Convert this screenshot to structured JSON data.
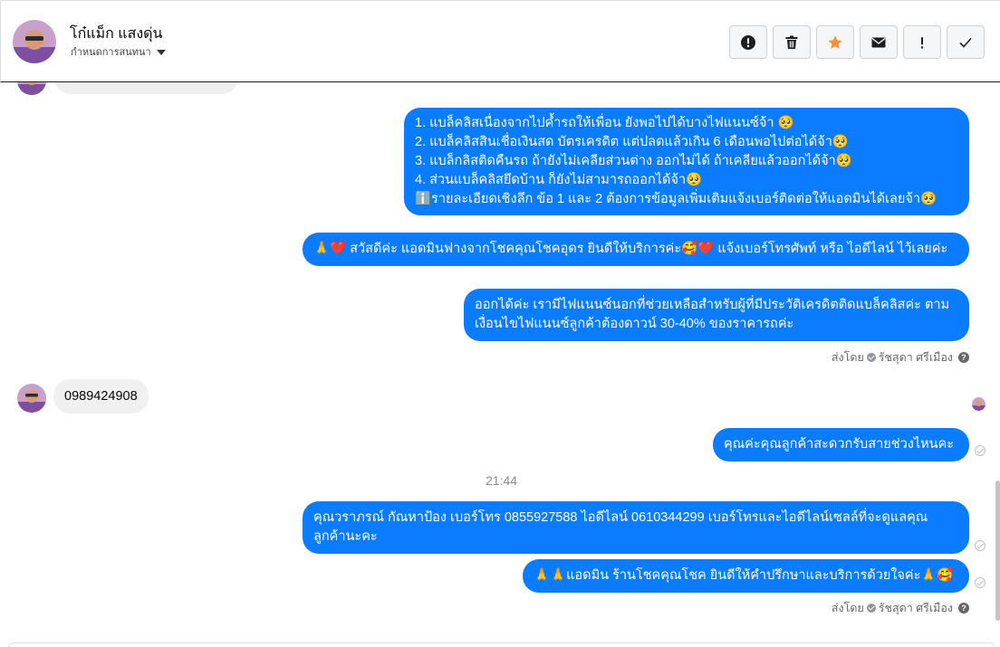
{
  "header": {
    "contact_name": "โก๋แม็ก แสงดุ่น",
    "assign_label": "กำหนดการสนทนา",
    "avatar_icon": "user-avatar",
    "toolbar": [
      {
        "name": "spam-button",
        "icon": "alert-circle-icon"
      },
      {
        "name": "delete-button",
        "icon": "trash-icon"
      },
      {
        "name": "star-button",
        "icon": "star-icon"
      },
      {
        "name": "mark-unread-button",
        "icon": "envelope-icon"
      },
      {
        "name": "follow-up-button",
        "icon": "exclamation-icon"
      },
      {
        "name": "mark-done-button",
        "icon": "checkmark-icon"
      }
    ]
  },
  "conversation": {
    "msg1_lines": [
      "1. แบล็คลิสเนื่องจากไปค้ำรถให้เพื่อน ยังพอไปได้บางไฟแนนซ์จ้า 🥺",
      "2. แบล็คลิสสินเชื่อเงินสด บัตรเครดิต แต่ปลดแล้วเกิน 6 เดือนพอไปต่อได้จ้า🥺",
      "3. แบล็กลิสติดคืนรถ ถ้ายังไม่เคลียส่วนต่าง ออกไม่ได้ ถ้าเคลียแล้วออกได้จ้า🥺",
      "4. ส่วนแบล็คลิสยึดบ้าน ก็ยังไม่สามารถออกได้จ้า🥺",
      "ℹ️รายละเอียดเชิงลึก ข้อ 1 และ 2 ต้องการข้อมูลเพิ่มเติมแจ้งเบอร์ติดต่อให้แอดมินได้เลยจ้า🥺"
    ],
    "msg2": "🙏❤️ สวัสดีค่ะ แอดมินฟางจากโชคคุณโชคอุดร ยินดีให้บริการค่ะ🥰❤️ แจ้งเบอร์โทรศัพท์ หรือ ไอดีไลน์  ไว้เลยค่ะ",
    "msg3": "ออกได้ค่ะ เรามีไฟแนนซ์นอกที่ช่วยเหลือสำหรับผู้ที่มีประวัติเครดิตติดแบล็คลิสค่ะ ตามเงื่อนไขไฟแนนซ์ลูกค้าต้องดาวน์ 30-40% ของราคารถค่ะ",
    "sent_by_label": "ส่งโดย",
    "sent_by_name": "รัชสุดา ศรีเมือง",
    "incoming_phone": "0989424908",
    "msg4": "คุณค่ะคุณลูกค้าสะดวกรับสายช่วงไหนคะ",
    "timestamp": "21:44",
    "msg5": "คุณวราภรณ์ กัณหาป้อง  เบอร์โทร 0855927588  ไอดีไลน์ 0610344299  เบอร์โทรและไอดีไลน์เซลล์ที่จะดูแลคุณลูกค้านะคะ",
    "msg6": "🙏🙏แอดมิน ร้านโชคคุณโชค ยินดีให้คำปรึกษาและบริการด้วยใจค่ะ🙏🥰"
  },
  "colors": {
    "outgoing_bubble": "#0a7cff",
    "incoming_bubble": "#f0f0f0",
    "star": "#f7923b"
  }
}
